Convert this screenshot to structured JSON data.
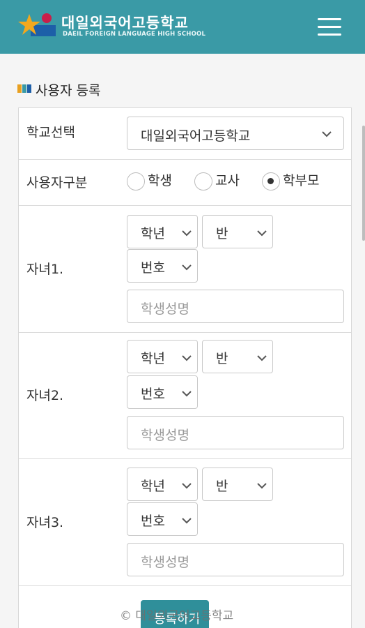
{
  "header": {
    "title_ko": "대일외국어고등학교",
    "title_en": "DAEIL FOREIGN LANGUAGE HIGH SCHOOL",
    "color": "#3a9aa6"
  },
  "section": {
    "title": "사용자 등록"
  },
  "form": {
    "school": {
      "label": "학교선택",
      "value": "대일외국어고등학교"
    },
    "user_type": {
      "label": "사용자구분",
      "options": [
        {
          "label": "학생",
          "selected": false
        },
        {
          "label": "교사",
          "selected": false
        },
        {
          "label": "학부모",
          "selected": true
        }
      ]
    },
    "children": [
      {
        "label": "자녀1.",
        "grade": "학년",
        "class": "반",
        "number": "번호",
        "name_placeholder": "학생성명"
      },
      {
        "label": "자녀2.",
        "grade": "학년",
        "class": "반",
        "number": "번호",
        "name_placeholder": "학생성명"
      },
      {
        "label": "자녀3.",
        "grade": "학년",
        "class": "반",
        "number": "번호",
        "name_placeholder": "학생성명"
      }
    ]
  },
  "submit_label": "등록하기",
  "footer": "© 대일외국어고등학교",
  "icons": {
    "menu": "hamburger-menu-icon",
    "dropdown": "chevron-down-icon"
  }
}
